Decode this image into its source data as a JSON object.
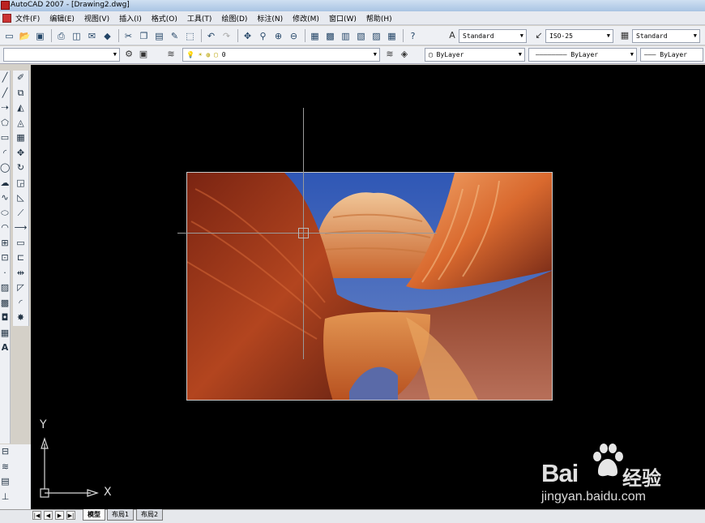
{
  "window": {
    "title": "AutoCAD 2007 - [Drawing2.dwg]"
  },
  "menu": {
    "items": [
      "文件(F)",
      "编辑(E)",
      "视图(V)",
      "插入(I)",
      "格式(O)",
      "工具(T)",
      "绘图(D)",
      "标注(N)",
      "修改(M)",
      "窗口(W)",
      "帮助(H)"
    ]
  },
  "styles": {
    "text_style": "Standard",
    "dim_style": "ISO-25",
    "table_style": "Standard"
  },
  "layers": {
    "workspace": "",
    "current_layer": "0",
    "color": "ByLayer",
    "linetype": "ByLayer",
    "lineweight": "ByLayer"
  },
  "ucs": {
    "x_label": "X",
    "y_label": "Y"
  },
  "tabs": {
    "items": [
      "模型",
      "布局1",
      "布局2"
    ],
    "active_index": 0
  },
  "watermark": {
    "brand": "Bai",
    "brand2": "经验",
    "url": "jingyan.baidu.com"
  },
  "colors": {
    "canvas": "#000000",
    "sky": "#3d5fb0",
    "rock": "#c0542a"
  },
  "icons": {
    "toolbar1": [
      "new-icon",
      "open-icon",
      "save-icon",
      "print-icon",
      "preview-icon",
      "publish-icon",
      "3d-dwf-icon",
      "cut-icon",
      "copy-icon",
      "paste-icon",
      "matchprop-icon",
      "block-editor-icon",
      "undo-icon",
      "redo-icon",
      "pan-icon",
      "zoom-realtime-icon",
      "zoom-window-icon",
      "zoom-previous-icon",
      "properties-icon",
      "design-center-icon",
      "tool-palettes-icon",
      "sheet-set-icon",
      "markup-icon",
      "quickcalc-icon",
      "help-icon"
    ]
  }
}
